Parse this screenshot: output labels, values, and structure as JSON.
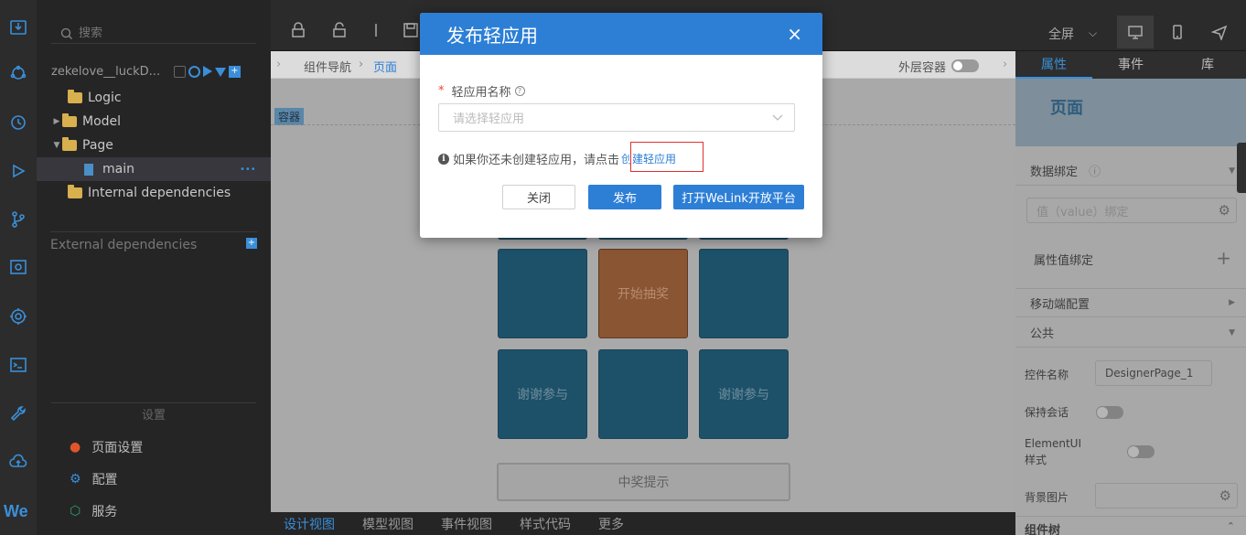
{
  "explorer": {
    "search_placeholder": "搜索",
    "project_name": "zekelove__luckD...",
    "tree": [
      {
        "label": "Logic",
        "type": "folder",
        "expanded": false
      },
      {
        "label": "Model",
        "type": "folder",
        "expanded": false
      },
      {
        "label": "Page",
        "type": "folder",
        "expanded": true
      },
      {
        "label": "main",
        "type": "file",
        "more": "•••"
      },
      {
        "label": "Internal dependencies",
        "type": "folder",
        "expanded": false
      }
    ],
    "external_deps": "External dependencies",
    "settings_title": "设置",
    "settings_items": [
      "页面设置",
      "配置",
      "服务"
    ],
    "brand": "We"
  },
  "toolbar": {
    "fullscreen": "全屏",
    "chevron": "⌵"
  },
  "breadcrumb": {
    "item1": "组件导航",
    "sep": "›",
    "item2": "页面",
    "outer_container": "外层容器"
  },
  "canvas": {
    "container_tag": "容器",
    "tiles": [
      {
        "text": ""
      },
      {
        "text": "开始抽奖"
      },
      {
        "text": ""
      },
      {
        "text": "谢谢参与"
      },
      {
        "text": ""
      },
      {
        "text": "谢谢参与"
      }
    ],
    "prize_hint": "中奖提示"
  },
  "bottom_tabs": {
    "items": [
      "设计视图",
      "模型视图",
      "事件视图",
      "样式代码",
      "更多"
    ],
    "active": 0
  },
  "props": {
    "tabs": [
      "属性",
      "事件",
      "库"
    ],
    "active_tab": 0,
    "banner_title": "页面",
    "data_binding": "数据绑定",
    "value_binding_placeholder": "值（value）绑定",
    "prop_value_binding": "属性值绑定",
    "mobile_config": "移动端配置",
    "common": "公共",
    "control_name_label": "控件名称",
    "control_name_value": "DesignerPage_1",
    "keep_session": "保持会话",
    "elementui_style": "ElementUI样式",
    "bg_image": "背景图片",
    "component_tree": "组件树"
  },
  "modal": {
    "title": "发布轻应用",
    "close": "×",
    "field_label": "轻应用名称",
    "required_mark": "*",
    "help": "?",
    "select_placeholder": "请选择轻应用",
    "info_icon": "i",
    "info_text": "如果你还未创建轻应用，请点击",
    "create_link": "创建轻应用",
    "btn_close": "关闭",
    "btn_publish": "发布",
    "btn_open_platform": "打开WeLink开放平台"
  },
  "colors": {
    "accent": "#2d7fd6",
    "tile": "#1d5169",
    "tile_orange": "#8a5533",
    "highlight_box": "#e03030"
  }
}
